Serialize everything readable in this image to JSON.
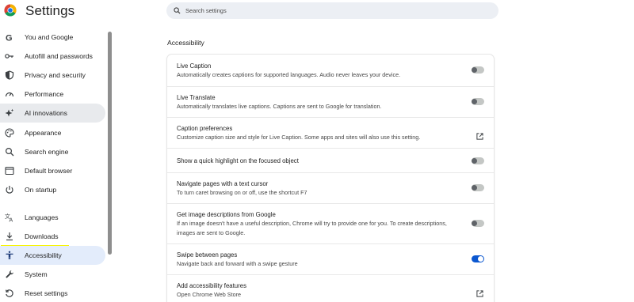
{
  "app": {
    "title": "Settings"
  },
  "search": {
    "placeholder": "Search settings"
  },
  "sidebar": {
    "items": [
      {
        "label": "You and Google",
        "icon": "google-icon"
      },
      {
        "label": "Autofill and passwords",
        "icon": "key-icon"
      },
      {
        "label": "Privacy and security",
        "icon": "shield-icon"
      },
      {
        "label": "Performance",
        "icon": "speedometer-icon"
      },
      {
        "label": "AI innovations",
        "icon": "sparkle-icon"
      },
      {
        "label": "Appearance",
        "icon": "palette-icon"
      },
      {
        "label": "Search engine",
        "icon": "search-icon"
      },
      {
        "label": "Default browser",
        "icon": "browser-icon"
      },
      {
        "label": "On startup",
        "icon": "power-icon"
      },
      {
        "label": "Languages",
        "icon": "translate-icon"
      },
      {
        "label": "Downloads",
        "icon": "download-icon"
      },
      {
        "label": "Accessibility",
        "icon": "accessibility-icon"
      },
      {
        "label": "System",
        "icon": "wrench-icon"
      },
      {
        "label": "Reset settings",
        "icon": "reset-icon"
      }
    ]
  },
  "main": {
    "section_title": "Accessibility",
    "rows": [
      {
        "title": "Live Caption",
        "desc": "Automatically creates captions for supported languages. Audio never leaves your device.",
        "control": "toggle",
        "on": false
      },
      {
        "title": "Live Translate",
        "desc": "Automatically translates live captions. Captions are sent to Google for translation.",
        "control": "toggle",
        "on": false
      },
      {
        "title": "Caption preferences",
        "desc": "Customize caption size and style for Live Caption. Some apps and sites will also use this setting.",
        "control": "external-link-icon"
      },
      {
        "title": "Show a quick highlight on the focused object",
        "desc": "",
        "control": "toggle",
        "on": false
      },
      {
        "title": "Navigate pages with a text cursor",
        "desc": "To turn caret browsing on or off, use the shortcut F7",
        "control": "toggle",
        "on": false
      },
      {
        "title": "Get image descriptions from Google",
        "desc": "If an image doesn't have a useful description, Chrome will try to provide one for you. To create descriptions, images are sent to Google.",
        "control": "toggle",
        "on": false
      },
      {
        "title": "Swipe between pages",
        "desc": "Navigate back and forward with a swipe gesture",
        "control": "toggle",
        "on": true
      },
      {
        "title": "Add accessibility features",
        "desc": "Open Chrome Web Store",
        "control": "external-link-icon"
      }
    ]
  },
  "colors": {
    "accent": "#0b57d0",
    "highlight": "#f8f400",
    "active_bg": "#e8eaed",
    "selected_bg": "#e3ecfb"
  }
}
